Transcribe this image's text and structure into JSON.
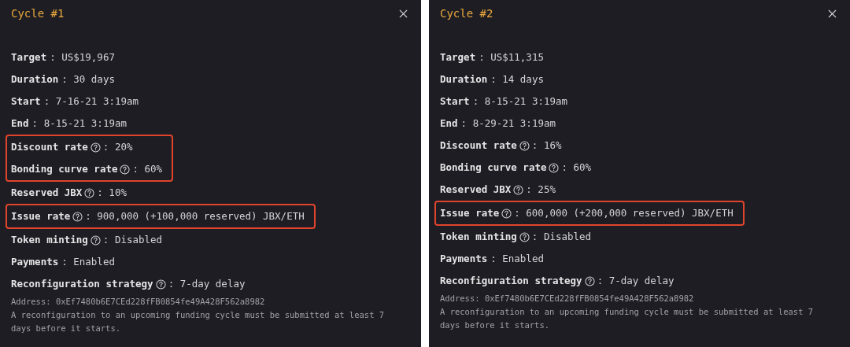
{
  "panels": [
    {
      "title": "Cycle #1",
      "fields": [
        {
          "label": "Target",
          "help": false,
          "value": ": US$19,967",
          "highlighted": false
        },
        {
          "label": "Duration",
          "help": false,
          "value": ": 30 days",
          "highlighted": false
        },
        {
          "label": "Start",
          "help": false,
          "value": ": 7-16-21 3:19am",
          "highlighted": false
        },
        {
          "label": "End",
          "help": false,
          "value": ": 8-15-21 3:19am",
          "highlighted": false
        },
        {
          "label": "Discount rate",
          "help": true,
          "value": ": 20%",
          "highlighted": true
        },
        {
          "label": "Bonding curve rate",
          "help": true,
          "value": ": 60%",
          "highlighted": true
        },
        {
          "label": "Reserved JBX",
          "help": true,
          "value": ": 10%",
          "highlighted": false
        },
        {
          "label": "Issue rate",
          "help": true,
          "value": ": 900,000 (+100,000 reserved) JBX/ETH",
          "highlighted": true
        },
        {
          "label": "Token minting",
          "help": true,
          "value": ": Disabled",
          "highlighted": false
        },
        {
          "label": "Payments",
          "help": false,
          "value": ": Enabled",
          "highlighted": false
        },
        {
          "label": "Reconfiguration strategy",
          "help": true,
          "value": ": 7-day delay",
          "highlighted": false
        }
      ],
      "address": "Address: 0xEf7480b6E7CEd228fFB0854fe49A428F562a8982",
      "note": "A reconfiguration to an upcoming funding cycle must be submitted at least 7 days before it starts."
    },
    {
      "title": "Cycle #2",
      "fields": [
        {
          "label": "Target",
          "help": false,
          "value": ": US$11,315",
          "highlighted": false
        },
        {
          "label": "Duration",
          "help": false,
          "value": ": 14 days",
          "highlighted": false
        },
        {
          "label": "Start",
          "help": false,
          "value": ": 8-15-21 3:19am",
          "highlighted": false
        },
        {
          "label": "End",
          "help": false,
          "value": ": 8-29-21 3:19am",
          "highlighted": false
        },
        {
          "label": "Discount rate",
          "help": true,
          "value": ": 16%",
          "highlighted": false
        },
        {
          "label": "Bonding curve rate",
          "help": true,
          "value": ": 60%",
          "highlighted": false
        },
        {
          "label": "Reserved JBX",
          "help": true,
          "value": ": 25%",
          "highlighted": false
        },
        {
          "label": "Issue rate",
          "help": true,
          "value": ": 600,000 (+200,000 reserved) JBX/ETH",
          "highlighted": true
        },
        {
          "label": "Token minting",
          "help": true,
          "value": ": Disabled",
          "highlighted": false
        },
        {
          "label": "Payments",
          "help": false,
          "value": ": Enabled",
          "highlighted": false
        },
        {
          "label": "Reconfiguration strategy",
          "help": true,
          "value": ": 7-day delay",
          "highlighted": false
        }
      ],
      "address": "Address: 0xEf7480b6E7CEd228fFB0854fe49A428F562a8982",
      "note": "A reconfiguration to an upcoming funding cycle must be submitted at least 7 days before it starts."
    }
  ]
}
